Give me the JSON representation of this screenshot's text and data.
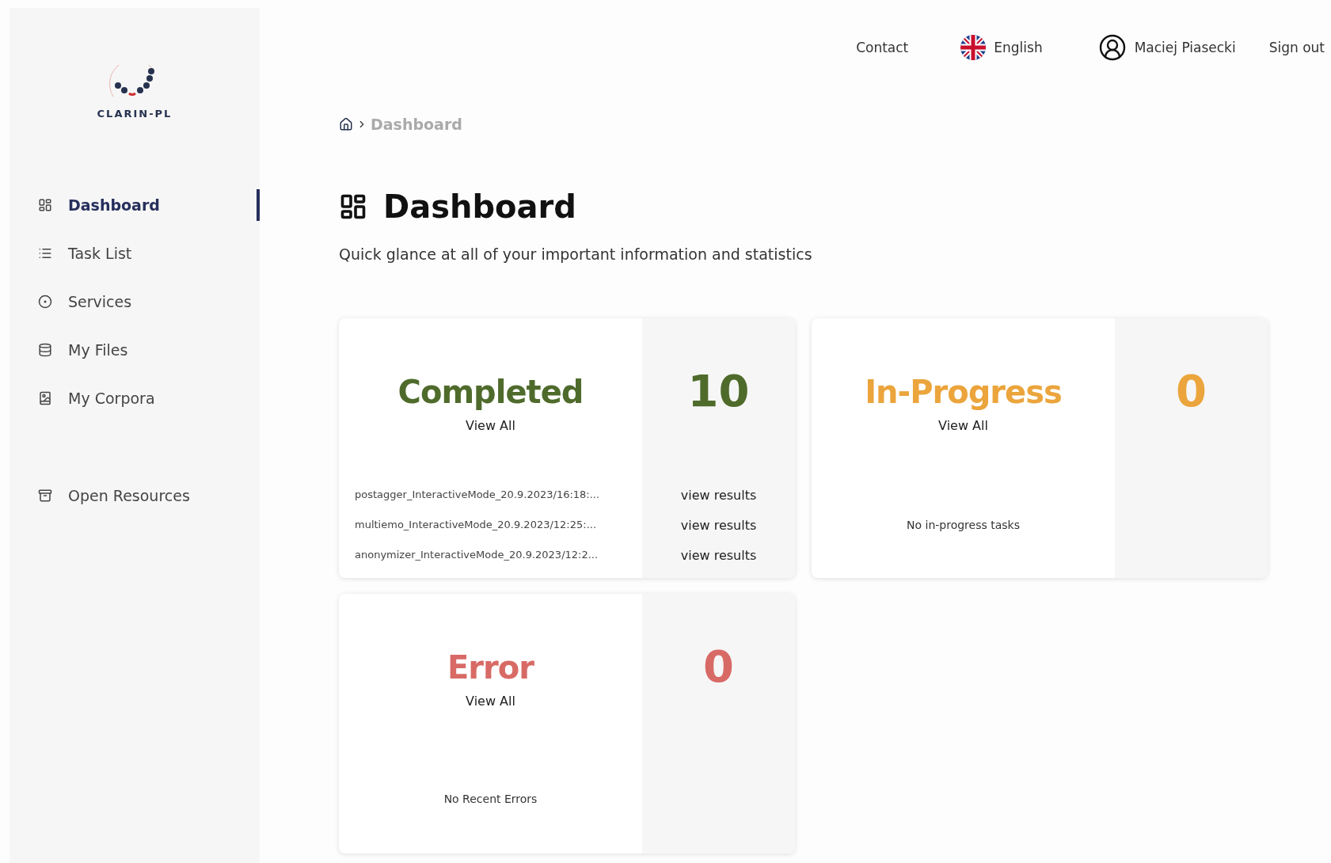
{
  "brand": {
    "name": "CLARIN-PL"
  },
  "sidebar": {
    "items": [
      {
        "label": "Dashboard",
        "selected": true
      },
      {
        "label": "Task List",
        "selected": false
      },
      {
        "label": "Services",
        "selected": false
      },
      {
        "label": "My Files",
        "selected": false
      },
      {
        "label": "My Corpora",
        "selected": false
      }
    ],
    "extra_items": [
      {
        "label": "Open Resources",
        "selected": false
      }
    ]
  },
  "header": {
    "contact": "Contact",
    "language": "English",
    "user": "Maciej Piasecki",
    "sign_out": "Sign out"
  },
  "breadcrumb": [
    "Dashboard"
  ],
  "page": {
    "title": "Dashboard",
    "subtitle": "Quick glance at all of your important information and statistics"
  },
  "cards": [
    {
      "title": "Completed",
      "color": "#4f6b2c",
      "count": "10",
      "view_all": "View All",
      "tasks": [
        {
          "name": "postagger_InteractiveMode_20.9.2023/16:18:...",
          "action": "view results"
        },
        {
          "name": "multiemo_InteractiveMode_20.9.2023/12:25:...",
          "action": "view results"
        },
        {
          "name": "anonymizer_InteractiveMode_20.9.2023/12:2...",
          "action": "view results"
        }
      ]
    },
    {
      "title": "In-Progress",
      "color": "#eba53c",
      "count": "0",
      "view_all": "View All",
      "empty": "No in-progress tasks"
    },
    {
      "title": "Error",
      "color": "#d86a66",
      "count": "0",
      "view_all": "View All",
      "empty": "No Recent Errors"
    }
  ]
}
